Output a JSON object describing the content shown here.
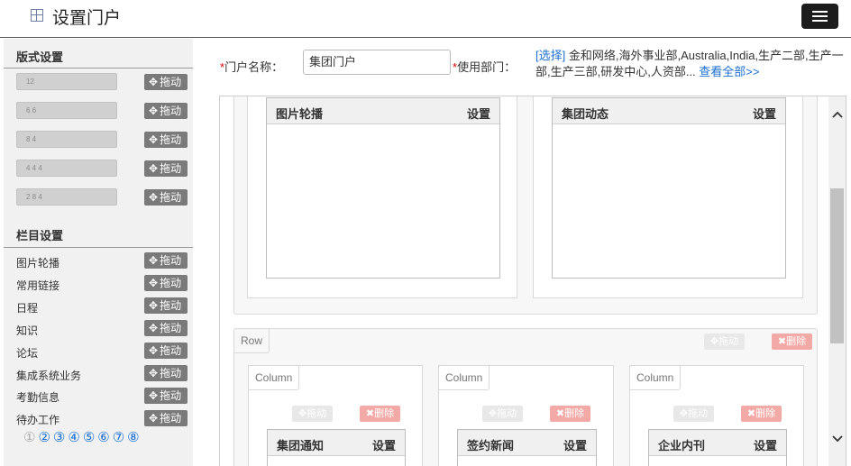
{
  "header": {
    "title": "设置门户",
    "menu_icon": "hamburger-icon"
  },
  "sidebar": {
    "layout_title": "版式设置",
    "presets": [
      "12",
      "6 6",
      "8 4",
      "4 4 4",
      "2 8 4"
    ],
    "drag_label": "拖动",
    "columns_title": "栏目设置",
    "columns": [
      "图片轮播",
      "常用链接",
      "日程",
      "知识",
      "论坛",
      "集成系统业务",
      "考勤信息",
      "待办工作"
    ],
    "pages": [
      "①",
      "②",
      "③",
      "④",
      "⑤",
      "⑥",
      "⑦",
      "⑧"
    ],
    "current_page": 0
  },
  "form": {
    "required_mark": "*",
    "name_label": "门户名称：",
    "name_value": "集团门户",
    "dept_label": "使用部门：",
    "dept_select": "[选择]",
    "dept_text": " 金和网络,海外事业部,Australia,India,生产二部,生产一部,生产三部,研发中心,人资部... ",
    "dept_view_all": "查看全部>>"
  },
  "canvas": {
    "top_row": [
      {
        "title": "图片轮播",
        "setting": "设置"
      },
      {
        "title": "集团动态",
        "setting": "设置"
      }
    ],
    "row": {
      "tag": "Row",
      "drag": "拖动",
      "delete": "删除",
      "columns": [
        {
          "tag": "Column",
          "drag": "拖动",
          "delete": "删除",
          "title": "集团通知",
          "setting": "设置"
        },
        {
          "tag": "Column",
          "drag": "拖动",
          "delete": "删除",
          "title": "签约新闻",
          "setting": "设置"
        },
        {
          "tag": "Column",
          "drag": "拖动",
          "delete": "删除",
          "title": "企业内刊",
          "setting": "设置"
        }
      ]
    }
  },
  "scrollbar": {
    "up": "^",
    "down": "v"
  },
  "colors": {
    "accent": "#1a6fd1",
    "required": "#e00000",
    "drag_button": "#7a7a7a",
    "menu_button": "#1c1c1c"
  }
}
